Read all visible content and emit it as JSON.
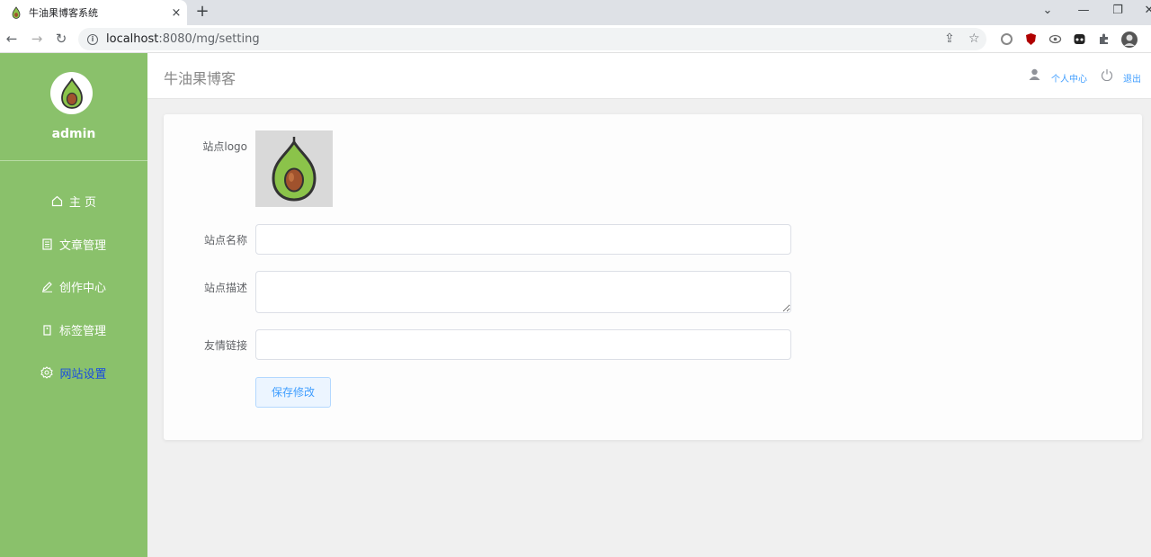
{
  "browser": {
    "tab_title": "牛油果博客系统",
    "tab_close": "×",
    "new_tab": "+",
    "url_host": "localhost",
    "url_rest": ":8080/mg/setting"
  },
  "sidebar": {
    "username": "admin",
    "items": [
      {
        "label": "主 页",
        "icon": "home-icon"
      },
      {
        "label": "文章管理",
        "icon": "document-icon"
      },
      {
        "label": "创作中心",
        "icon": "pen-icon"
      },
      {
        "label": "标签管理",
        "icon": "tag-icon"
      },
      {
        "label": "网站设置",
        "icon": "gear-icon",
        "active": true
      }
    ]
  },
  "header": {
    "title": "牛油果博客",
    "profile_label": "个人中心",
    "logout_label": "退出"
  },
  "form": {
    "logo_label": "站点logo",
    "name_label": "站点名称",
    "name_value": "",
    "desc_label": "站点描述",
    "desc_value": "",
    "links_label": "友情链接",
    "links_value": "",
    "save_label": "保存修改"
  },
  "colors": {
    "sidebar_bg": "#8ac16b",
    "active_menu": "#1a4de0",
    "link": "#409eff"
  }
}
